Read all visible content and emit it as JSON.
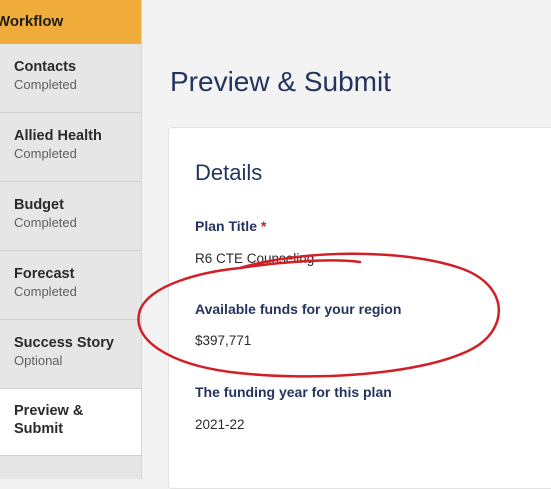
{
  "sidebar": {
    "header": "Workflow",
    "items": [
      {
        "label": "Contacts",
        "status": "Completed"
      },
      {
        "label": "Allied Health",
        "status": "Completed"
      },
      {
        "label": "Budget",
        "status": "Completed"
      },
      {
        "label": "Forecast",
        "status": "Completed"
      },
      {
        "label": "Success Story",
        "status": "Optional"
      },
      {
        "label": "Preview &\nSubmit",
        "status": ""
      }
    ]
  },
  "main": {
    "title": "Preview & Submit",
    "details": {
      "title": "Details",
      "fields": [
        {
          "label": "Plan Title",
          "required_mark": "*",
          "value": "R6 CTE Counseling"
        },
        {
          "label": "Available funds for your region",
          "value": "$397,771"
        },
        {
          "label": "The funding year for this plan",
          "value": "2021-22"
        }
      ]
    }
  },
  "colors": {
    "accent": "#f0ac3a",
    "title_blue": "#23345e",
    "annotation_red": "#d21f26"
  }
}
